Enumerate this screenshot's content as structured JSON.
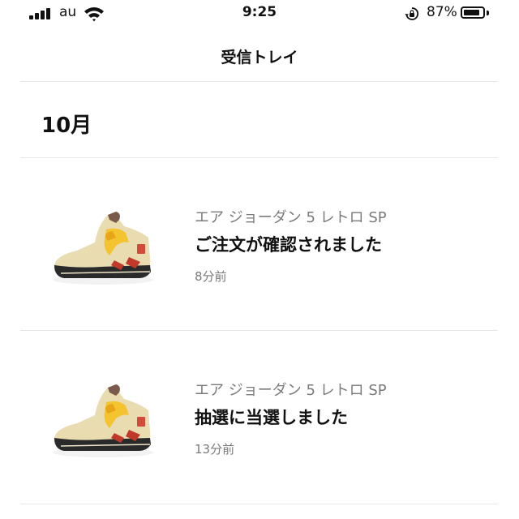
{
  "status_bar": {
    "carrier": "au",
    "time": "9:25",
    "battery_percent": "87%",
    "battery_level": 0.87,
    "signal_bars": 4
  },
  "header": {
    "title": "受信トレイ"
  },
  "section": {
    "title": "10月"
  },
  "notifications": [
    {
      "product": "エア ジョーダン 5 レトロ SP",
      "message": "ご注文が確認されました",
      "time_ago": "8分前",
      "icon": "sneaker-thumbnail-icon"
    },
    {
      "product": "エア ジョーダン 5 レトロ SP",
      "message": "抽選に当選しました",
      "time_ago": "13分前",
      "icon": "sneaker-thumbnail-icon"
    }
  ]
}
